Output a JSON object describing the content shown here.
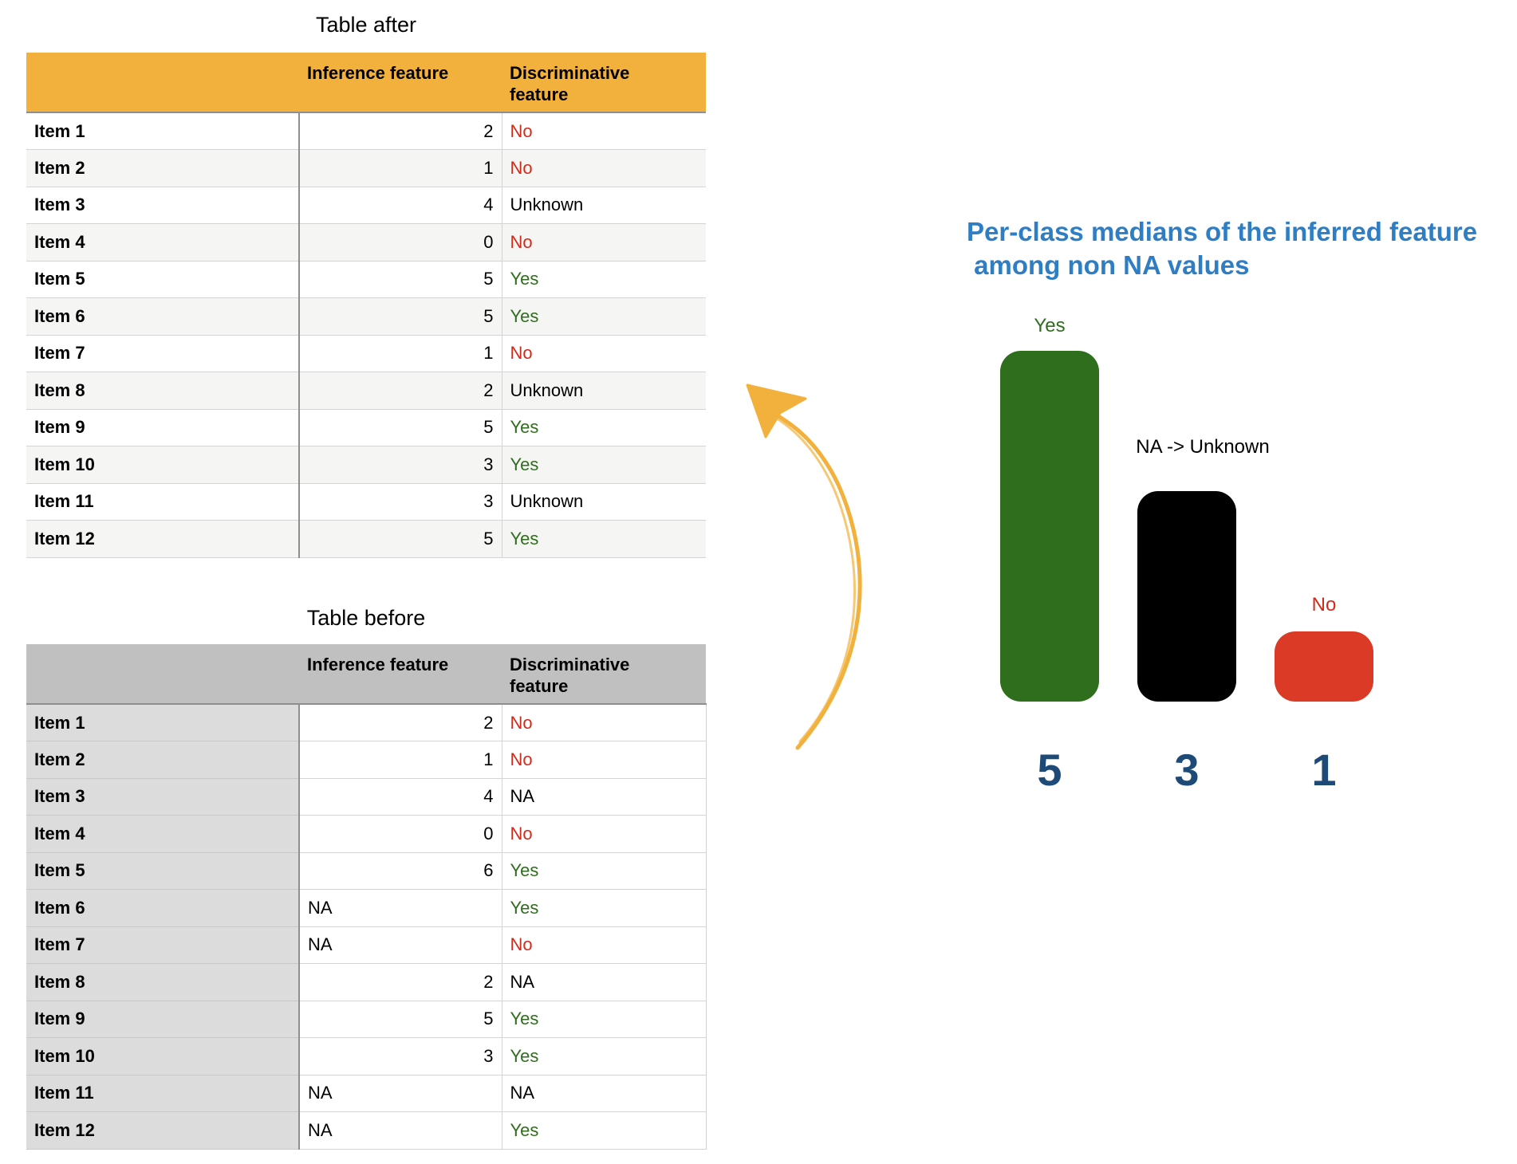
{
  "after_table": {
    "title": "Table after",
    "headers": [
      "",
      "Inference feature",
      "Discriminative\nfeature"
    ],
    "rows": [
      {
        "label": "Item 1",
        "inference": "2",
        "disc": "No",
        "cls": "no"
      },
      {
        "label": "Item 2",
        "inference": "1",
        "disc": "No",
        "cls": "no"
      },
      {
        "label": "Item 3",
        "inference": "4",
        "disc": "Unknown",
        "cls": "unknown"
      },
      {
        "label": "Item 4",
        "inference": "0",
        "disc": "No",
        "cls": "no"
      },
      {
        "label": "Item 5",
        "inference": "5",
        "disc": "Yes",
        "cls": "yes"
      },
      {
        "label": "Item 6",
        "inference": "5",
        "disc": "Yes",
        "cls": "yes"
      },
      {
        "label": "Item 7",
        "inference": "1",
        "disc": "No",
        "cls": "no"
      },
      {
        "label": "Item 8",
        "inference": "2",
        "disc": "Unknown",
        "cls": "unknown"
      },
      {
        "label": "Item 9",
        "inference": "5",
        "disc": "Yes",
        "cls": "yes"
      },
      {
        "label": "Item 10",
        "inference": "3",
        "disc": "Yes",
        "cls": "yes"
      },
      {
        "label": "Item 11",
        "inference": "3",
        "disc": "Unknown",
        "cls": "unknown"
      },
      {
        "label": "Item 12",
        "inference": "5",
        "disc": "Yes",
        "cls": "yes"
      }
    ]
  },
  "before_table": {
    "title": "Table before",
    "headers": [
      "",
      "Inference feature",
      "Discriminative\nfeature"
    ],
    "rows": [
      {
        "label": "Item 1",
        "inference": "2",
        "disc": "No",
        "cls": "no"
      },
      {
        "label": "Item 2",
        "inference": "1",
        "disc": "No",
        "cls": "no"
      },
      {
        "label": "Item 3",
        "inference": "4",
        "disc": "NA",
        "cls": "na"
      },
      {
        "label": "Item 4",
        "inference": "0",
        "disc": "No",
        "cls": "no"
      },
      {
        "label": "Item 5",
        "inference": "6",
        "disc": "Yes",
        "cls": "yes"
      },
      {
        "label": "Item 6",
        "inference": "NA",
        "disc": "Yes",
        "cls": "yes"
      },
      {
        "label": "Item 7",
        "inference": "NA",
        "disc": "No",
        "cls": "no"
      },
      {
        "label": "Item 8",
        "inference": "2",
        "disc": "NA",
        "cls": "na"
      },
      {
        "label": "Item 9",
        "inference": "5",
        "disc": "Yes",
        "cls": "yes"
      },
      {
        "label": "Item 10",
        "inference": "3",
        "disc": "Yes",
        "cls": "yes"
      },
      {
        "label": "Item 11",
        "inference": "NA",
        "disc": "NA",
        "cls": "na"
      },
      {
        "label": "Item 12",
        "inference": "NA",
        "disc": "Yes",
        "cls": "yes"
      }
    ]
  },
  "chart": {
    "title": "Per-class medians of the inferred feature\n among non NA values"
  },
  "chart_data": {
    "type": "bar",
    "title": "Per-class medians of the inferred feature\n among non NA values",
    "categories": [
      "Yes",
      "NA -> Unknown",
      "No"
    ],
    "values": [
      5,
      3,
      1
    ],
    "value_labels": [
      "5",
      "3",
      "1"
    ],
    "colors": [
      "#2f6e1c",
      "#000000",
      "#db3a26"
    ],
    "category_label_colors": [
      "#2f6e1c",
      "#000000",
      "#d42a1a"
    ],
    "value_label_color": "#1e4a78",
    "xlabel": "",
    "ylabel": "",
    "grid": false
  },
  "colors": {
    "after_header": "#f2b13c",
    "before_header": "#c0c0c0",
    "yes": "#2f6e1c",
    "no": "#d42a1a",
    "title_blue": "#2f7ec4",
    "arrow": "#f2b13c"
  },
  "arrow": {
    "icon": "curved-arrow-up-icon"
  }
}
